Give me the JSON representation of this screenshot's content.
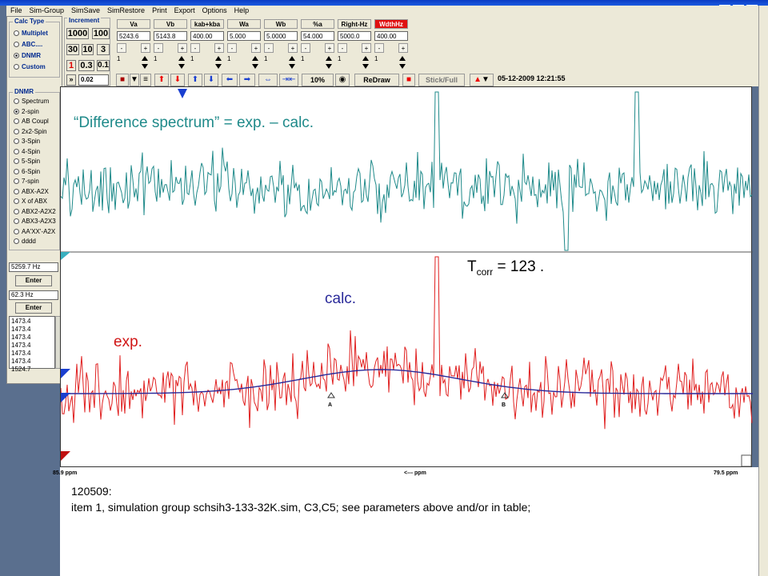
{
  "menu": [
    "File",
    "Sim-Group",
    "SimSave",
    "SimRestore",
    "Print",
    "Export",
    "Options",
    "Help"
  ],
  "calc_type": {
    "title": "Calc Type",
    "options": [
      "Multiplet",
      "ABC....",
      "DNMR",
      "Custom"
    ],
    "selected": "DNMR"
  },
  "increment": {
    "title": "Increment",
    "buttons": [
      "1000",
      "100",
      "30",
      "10",
      "3",
      "1",
      "0.3",
      "0.1"
    ],
    "value": "0.02"
  },
  "params": [
    {
      "label": "Va",
      "value": "5243.6",
      "one": "1"
    },
    {
      "label": "Vb",
      "value": "5143.8",
      "one": "1"
    },
    {
      "label": "kab+kba",
      "value": "400.00",
      "one": "1"
    },
    {
      "label": "Wa",
      "value": "5.000",
      "one": "1"
    },
    {
      "label": "Wb",
      "value": "5.0000",
      "one": "1"
    },
    {
      "label": "%a",
      "value": "54.000",
      "one": "1"
    },
    {
      "label": "Right-Hz",
      "value": "5000.0",
      "one": "1"
    },
    {
      "label": "WdthHz",
      "value": "400.00",
      "one": "1"
    }
  ],
  "dnmr": {
    "title": "DNMR",
    "options": [
      "Spectrum",
      "2-spin",
      "AB Coupl",
      "2x2-Spin",
      "3-Spin",
      "4-Spin",
      "5-Spin",
      "6-Spin",
      "7-spin",
      "ABX-A2X",
      "X of ABX",
      "ABX2-A2X2",
      "ABX3-A2X3",
      "AA'XX'-A2X",
      "dddd"
    ],
    "selected": "2-spin"
  },
  "hz_field_1": "5259.7 Hz",
  "hz_field_2": "62.3 Hz",
  "enter_label": "Enter",
  "peak_list": [
    "1473.4",
    "1473.4",
    "1473.4",
    "1473.4",
    "1473.4",
    "1473.4",
    "1524.7"
  ],
  "toolbar": {
    "zoom": "10%",
    "redraw": "ReDraw",
    "stick_full": "Stick/Full"
  },
  "datestamp": "05-12-2009  12:21:55",
  "annotations": {
    "difference": "“Difference spectrum” = exp. – calc.",
    "tcorr_main": "T",
    "tcorr_sub": "corr",
    "tcorr_value": " = 123  .",
    "calc": "calc.",
    "exp": "exp.",
    "marker_a": "A",
    "marker_b": "B"
  },
  "ppm_axis": {
    "left": "85.9 ppm",
    "center": "<--- ppm",
    "right": "79.5 ppm"
  },
  "notes": {
    "line1": "120509:",
    "line2": "item 1, simulation group schsih3-133-32K.sim,  C3,C5; see parameters above and/or in table;"
  },
  "colors": {
    "difference_trace": "#1f8a8a",
    "exp_trace": "#e02020",
    "calc_trace": "#2a2a9a",
    "window_bg": "#5a6f8e",
    "panel_bg": "#ece9d8"
  }
}
